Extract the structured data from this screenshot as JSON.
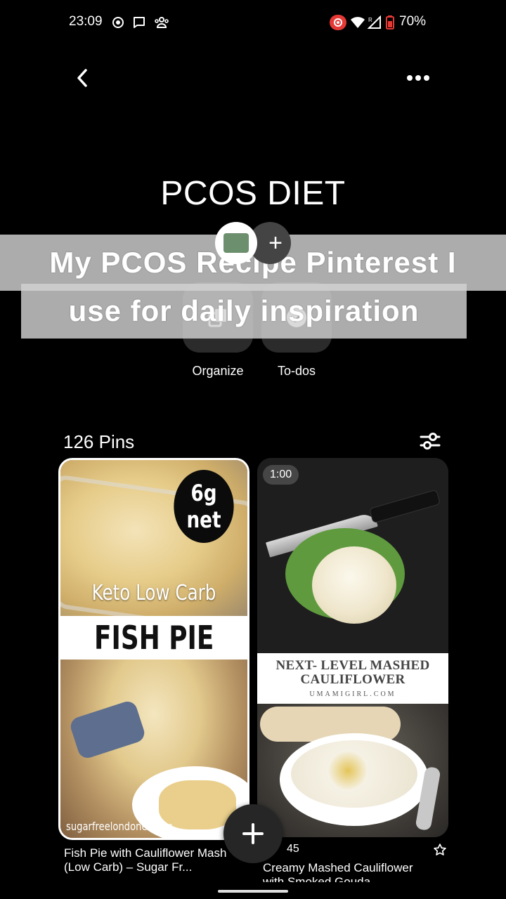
{
  "status_bar": {
    "time": "23:09",
    "battery": "70%",
    "icons": [
      "record-icon",
      "message-icon",
      "people-icon",
      "screen-record-icon",
      "wifi-icon",
      "signal-icon",
      "battery-icon"
    ],
    "record_color": "#e53935",
    "battery_color": "#e53935"
  },
  "nav": {
    "back_icon": "chevron-left-icon",
    "more_icon": "more-horizontal-icon"
  },
  "board": {
    "title": "PCOS DIET",
    "add_collaborator_symbol": "+"
  },
  "actions": [
    {
      "label": "Organize",
      "icon": "organize-icon"
    },
    {
      "label": "To-dos",
      "icon": "todo-icon"
    }
  ],
  "caption": {
    "line1": "My PCOS Recipe Pinterest I",
    "line2": "use for daily inspiration"
  },
  "pins_header": {
    "count_label": "126 Pins",
    "filter_icon": "filter-sliders-icon"
  },
  "pins": [
    {
      "title": "Fish Pie with Cauliflower Mash (Low Carb) – Sugar Fr...",
      "image": {
        "badge_line1": "6g",
        "badge_line2": "net",
        "subtitle": "Keto Low Carb",
        "headline": "FISH PIE",
        "watermark": "sugarfreelondoner.com"
      }
    },
    {
      "title": "Creamy Mashed Cauliflower with Smoked Gouda",
      "count": "45",
      "image": {
        "duration": "1:00",
        "headline": "NEXT- LEVEL MASHED CAULIFLOWER",
        "site": "UMAMIGIRL.COM"
      }
    }
  ],
  "fab": {
    "icon": "plus-icon"
  }
}
